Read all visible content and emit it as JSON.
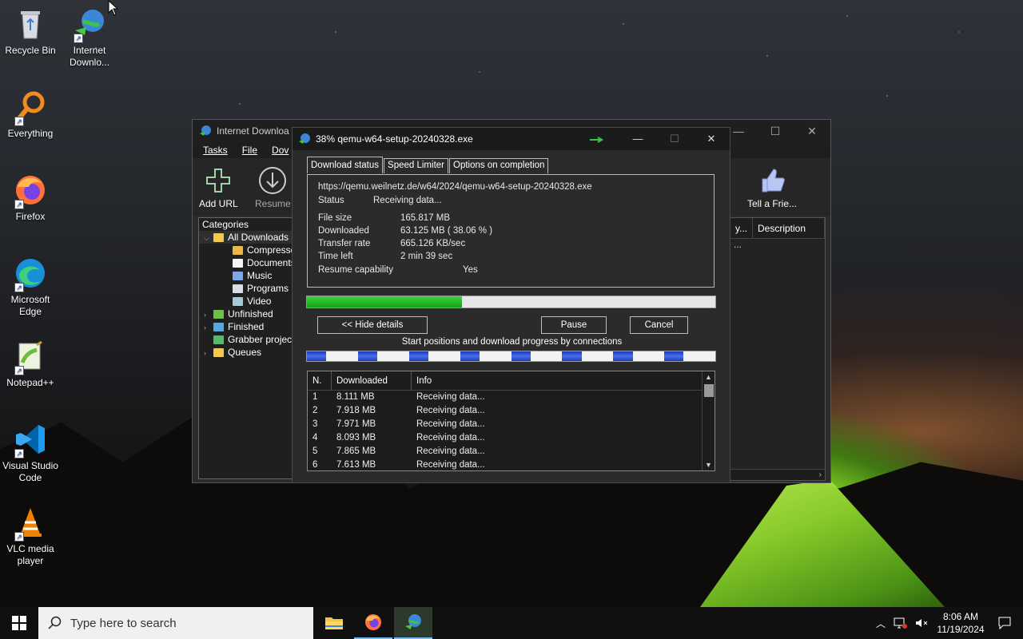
{
  "desktop": {
    "icons": [
      {
        "label": "Recycle Bin"
      },
      {
        "label": "Internet Downlo..."
      },
      {
        "label": "Everything"
      },
      {
        "label": "Firefox"
      },
      {
        "label": "Microsoft Edge"
      },
      {
        "label": "Notepad++"
      },
      {
        "label": "Visual Studio Code"
      },
      {
        "label": "VLC media player"
      }
    ]
  },
  "main_window": {
    "title": "Internet Downloa",
    "menu": [
      "Tasks",
      "File",
      "Dov"
    ],
    "toolbar": {
      "add_url": "Add URL",
      "resume": "Resume",
      "tell_friend": "Tell a Frie..."
    },
    "categories_header": "Categories",
    "tree": [
      {
        "label": "All Downloads",
        "level": 0
      },
      {
        "label": "Compresse",
        "level": 1
      },
      {
        "label": "Documents",
        "level": 1
      },
      {
        "label": "Music",
        "level": 1
      },
      {
        "label": "Programs",
        "level": 1
      },
      {
        "label": "Video",
        "level": 1
      },
      {
        "label": "Unfinished",
        "level": 0
      },
      {
        "label": "Finished",
        "level": 0
      },
      {
        "label": "Grabber projec",
        "level": 0
      },
      {
        "label": "Queues",
        "level": 0
      }
    ],
    "list_columns": [
      "y...",
      "Description"
    ],
    "list_row_cell": "..."
  },
  "dialog": {
    "title": "38% qemu-w64-setup-20240328.exe",
    "tabs": [
      "Download status",
      "Speed Limiter",
      "Options on completion"
    ],
    "url": "https://qemu.weilnetz.de/w64/2024/qemu-w64-setup-20240328.exe",
    "status_label": "Status",
    "status_value": "Receiving data...",
    "file_size_label": "File size",
    "file_size_value": "165.817  MB",
    "downloaded_label": "Downloaded",
    "downloaded_value": "63.125  MB  ( 38.06 % )",
    "transfer_rate_label": "Transfer rate",
    "transfer_rate_value": "665.126  KB/sec",
    "time_left_label": "Time left",
    "time_left_value": "2 min 39 sec",
    "resume_label": "Resume capability",
    "resume_value": "Yes",
    "progress_fraction": 0.3806,
    "hide_details": "<< Hide details",
    "pause": "Pause",
    "cancel": "Cancel",
    "connections_label": "Start positions and download progress by connections",
    "connection_columns": [
      "N.",
      "Downloaded",
      "Info"
    ],
    "connections": [
      {
        "n": "1",
        "downloaded": "8.111  MB",
        "info": "Receiving data..."
      },
      {
        "n": "2",
        "downloaded": "7.918  MB",
        "info": "Receiving data..."
      },
      {
        "n": "3",
        "downloaded": "7.971  MB",
        "info": "Receiving data..."
      },
      {
        "n": "4",
        "downloaded": "8.093  MB",
        "info": "Receiving data..."
      },
      {
        "n": "5",
        "downloaded": "7.865  MB",
        "info": "Receiving data..."
      },
      {
        "n": "6",
        "downloaded": "7.613  MB",
        "info": "Receiving data..."
      }
    ]
  },
  "taskbar": {
    "search_placeholder": "Type here to search",
    "time": "8:06 AM",
    "date": "11/19/2024"
  },
  "colors": {
    "progress_green": "#22b522",
    "segment_blue": "#2a4ad0",
    "accent": "#76b9ed"
  }
}
